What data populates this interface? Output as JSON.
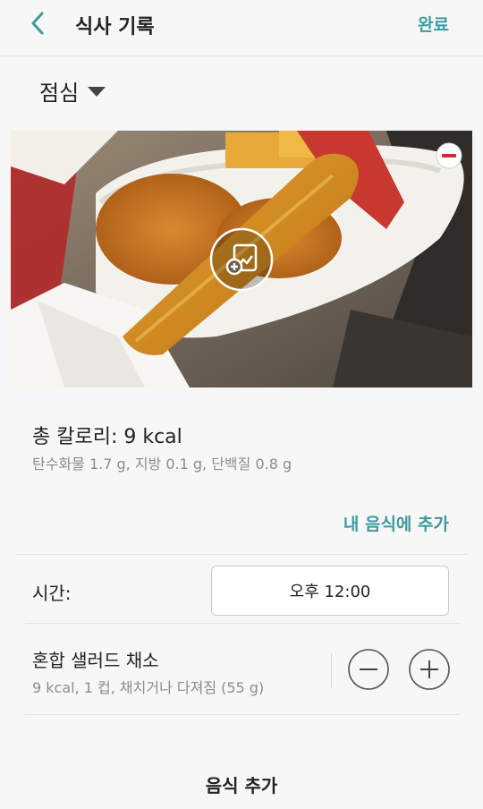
{
  "header": {
    "title": "식사 기록",
    "done_label": "완료"
  },
  "meal": {
    "selected": "점심"
  },
  "summary": {
    "total_calories": "총 칼로리: 9 kcal",
    "nutrients": "탄수화물 1.7 g, 지방 0.1 g, 단백질 0.8 g",
    "add_to_my_food": "내 음식에 추가"
  },
  "time": {
    "label": "시간:",
    "value": "오후 12:00"
  },
  "food_item": {
    "name": "혼합 샐러드 채소",
    "detail": "9 kcal, 1 컵, 채치거나 다져짐 (55 g)"
  },
  "footer": {
    "add_food_label": "음식 추가"
  },
  "colors": {
    "accent": "#3e9aa0",
    "remove": "#d6263a"
  }
}
